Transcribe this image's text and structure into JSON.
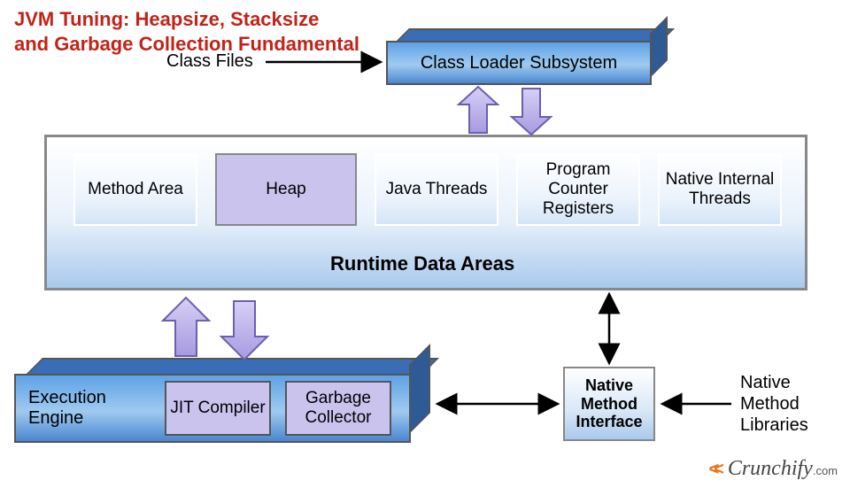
{
  "title_line1": "JVM Tuning: Heapsize, Stacksize",
  "title_line2": "and Garbage Collection Fundamental",
  "class_files_label": "Class Files",
  "class_loader": {
    "label": "Class Loader Subsystem"
  },
  "rda": {
    "title": "Runtime Data Areas",
    "cells": {
      "method_area": "Method Area",
      "heap": "Heap",
      "java_threads": "Java Threads",
      "pc_registers": "Program Counter Registers",
      "native_threads": "Native Internal Threads"
    }
  },
  "exec_engine": {
    "label": "Execution Engine",
    "jit": "JIT Compiler",
    "gc": "Garbage Collector"
  },
  "nmi_label": "Native Method Interface",
  "nml_label": "Native Method Libraries",
  "logo": {
    "brand": "Crunchify",
    "suffix": ".com"
  }
}
